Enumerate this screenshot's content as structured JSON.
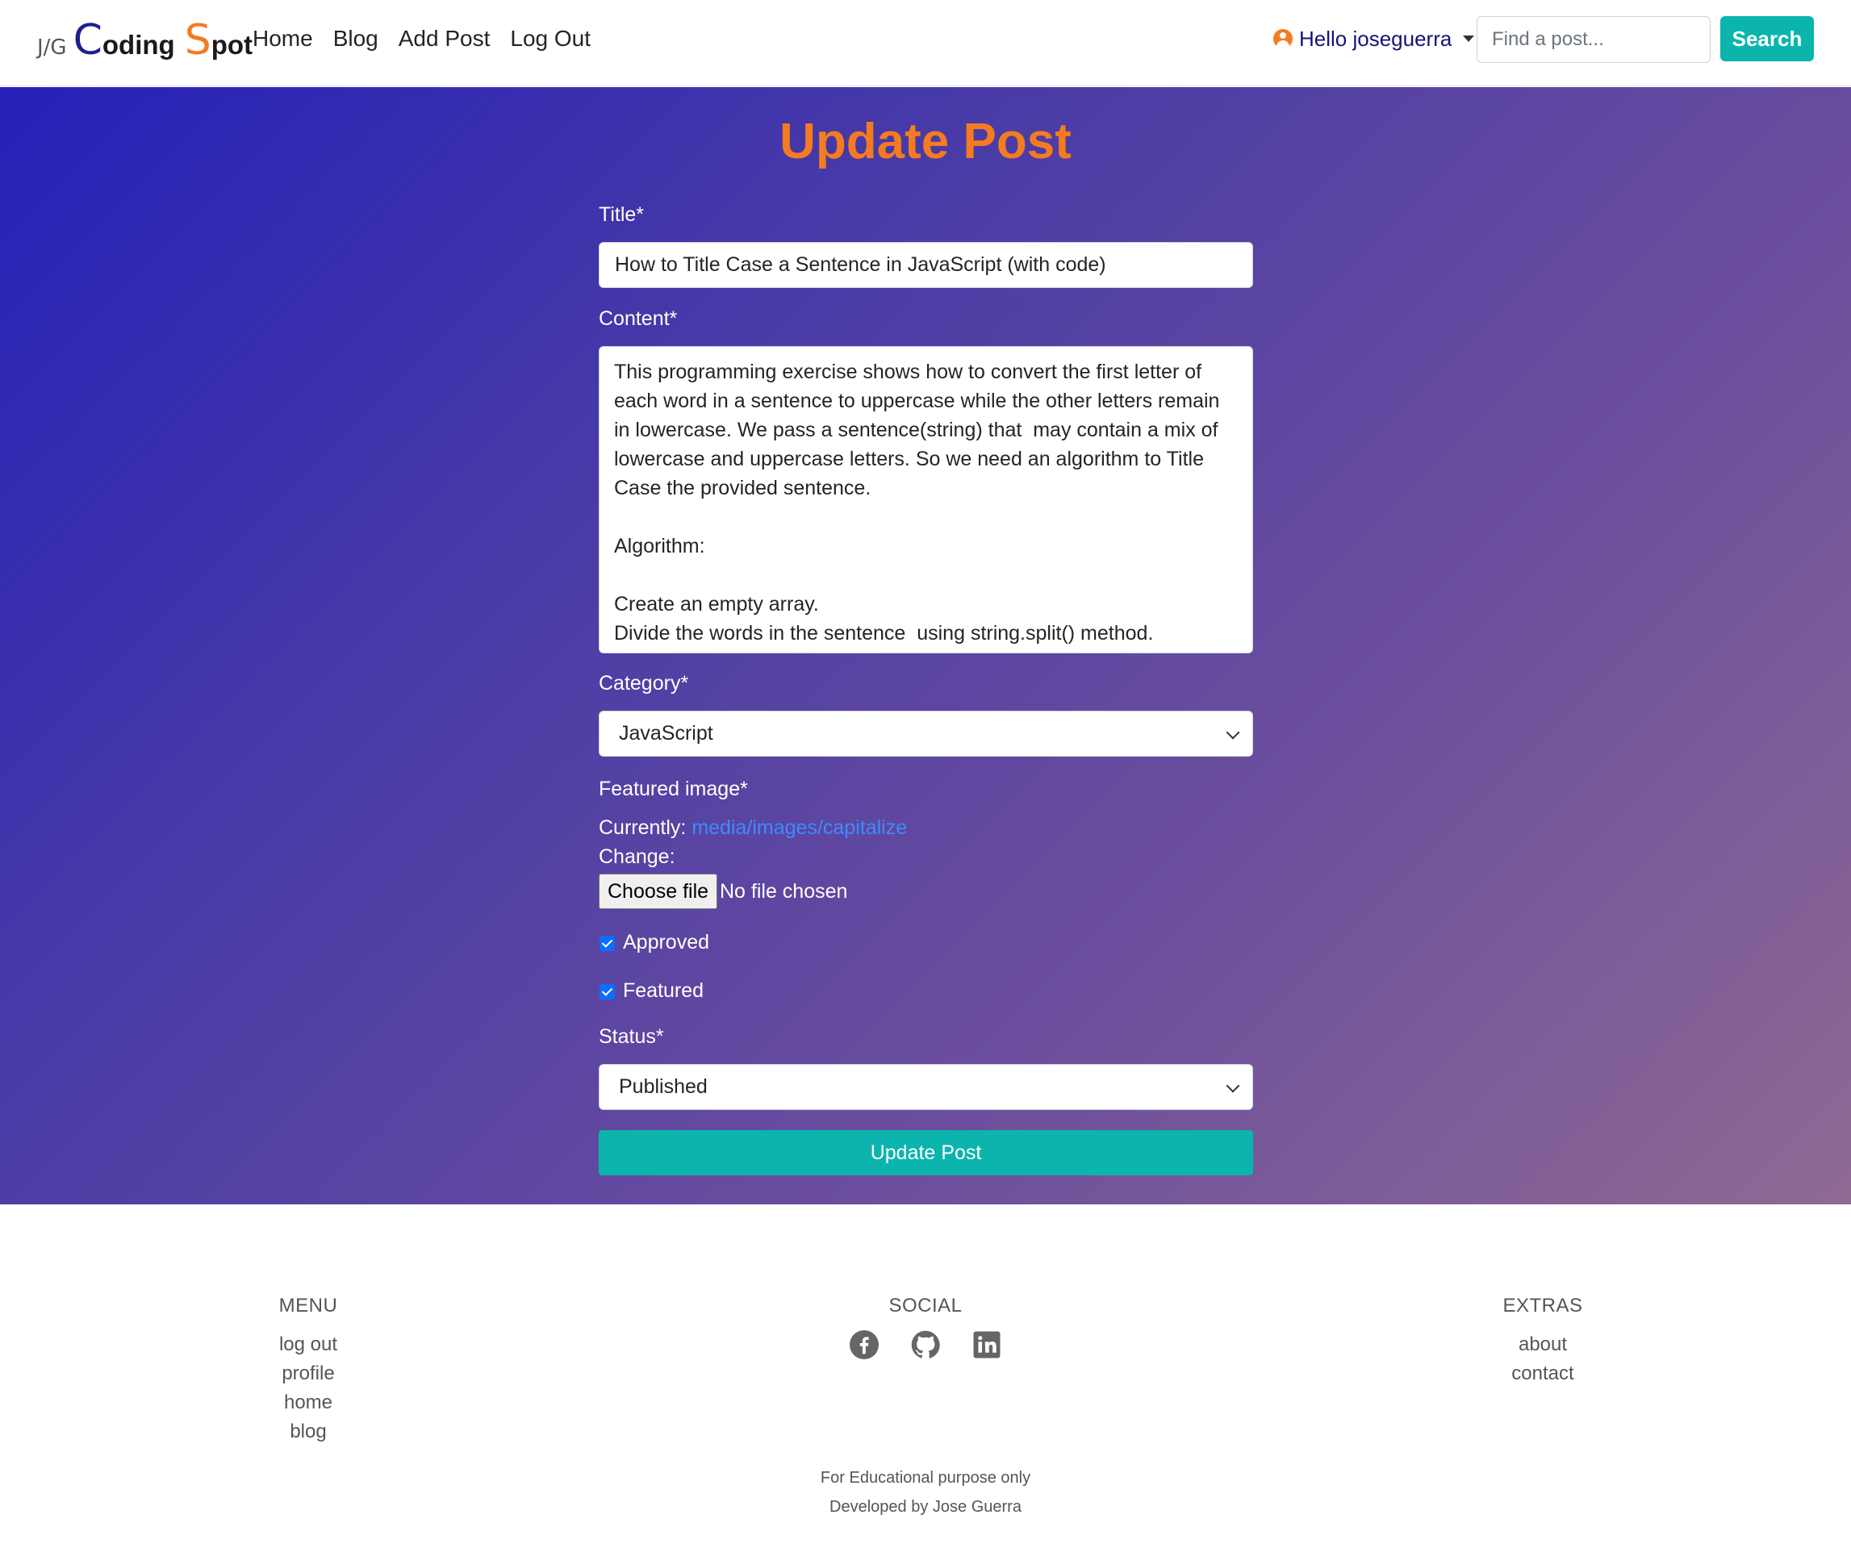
{
  "brand": {
    "prefix": "J/G",
    "c": "C",
    "oding": "oding",
    "s": "S",
    "pot": "pot"
  },
  "nav": {
    "items": [
      "Home",
      "Blog",
      "Add Post",
      "Log Out"
    ]
  },
  "user_menu": {
    "label": "Hello joseguerra"
  },
  "search": {
    "placeholder": "Find a post...",
    "button_label": "Search"
  },
  "colors": {
    "accent_orange": "#f47b20",
    "accent_teal": "#0bb5ad",
    "brand_blue": "#1b1f8f",
    "link_blue": "#3d8bfd"
  },
  "form": {
    "heading": "Update Post",
    "title_label": "Title*",
    "title_value": "How to Title Case a Sentence in JavaScript (with code)",
    "content_label": "Content*",
    "content_value": "This programming exercise shows how to convert the first letter of each word in a sentence to uppercase while the other letters remain in lowercase. We pass a sentence(string) that  may contain a mix of lowercase and uppercase letters. So we need an algorithm to Title Case the provided sentence.\n\nAlgorithm:\n\nCreate an empty array.\nDivide the words in the sentence  using string.split() method.",
    "category_label": "Category*",
    "category_value": "JavaScript",
    "image_label": "Featured image*",
    "currently_label": "Currently:",
    "currently_link": "media/images/capitalize",
    "change_label": "Change:",
    "choose_file_label": "Choose file",
    "no_file_text": "No file chosen",
    "approved_label": "Approved",
    "approved_checked": true,
    "featured_label": "Featured",
    "featured_checked": true,
    "status_label": "Status*",
    "status_value": "Published",
    "submit_label": "Update Post"
  },
  "footer": {
    "menu_heading": "MENU",
    "menu_links": [
      "log out",
      "profile",
      "home",
      "blog"
    ],
    "social_heading": "SOCIAL",
    "social_icons": [
      "facebook-icon",
      "github-icon",
      "linkedin-icon"
    ],
    "extras_heading": "EXTRAS",
    "extras_links": [
      "about",
      "contact"
    ],
    "note_1": "For Educational purpose only",
    "note_2": "Developed by Jose Guerra"
  }
}
